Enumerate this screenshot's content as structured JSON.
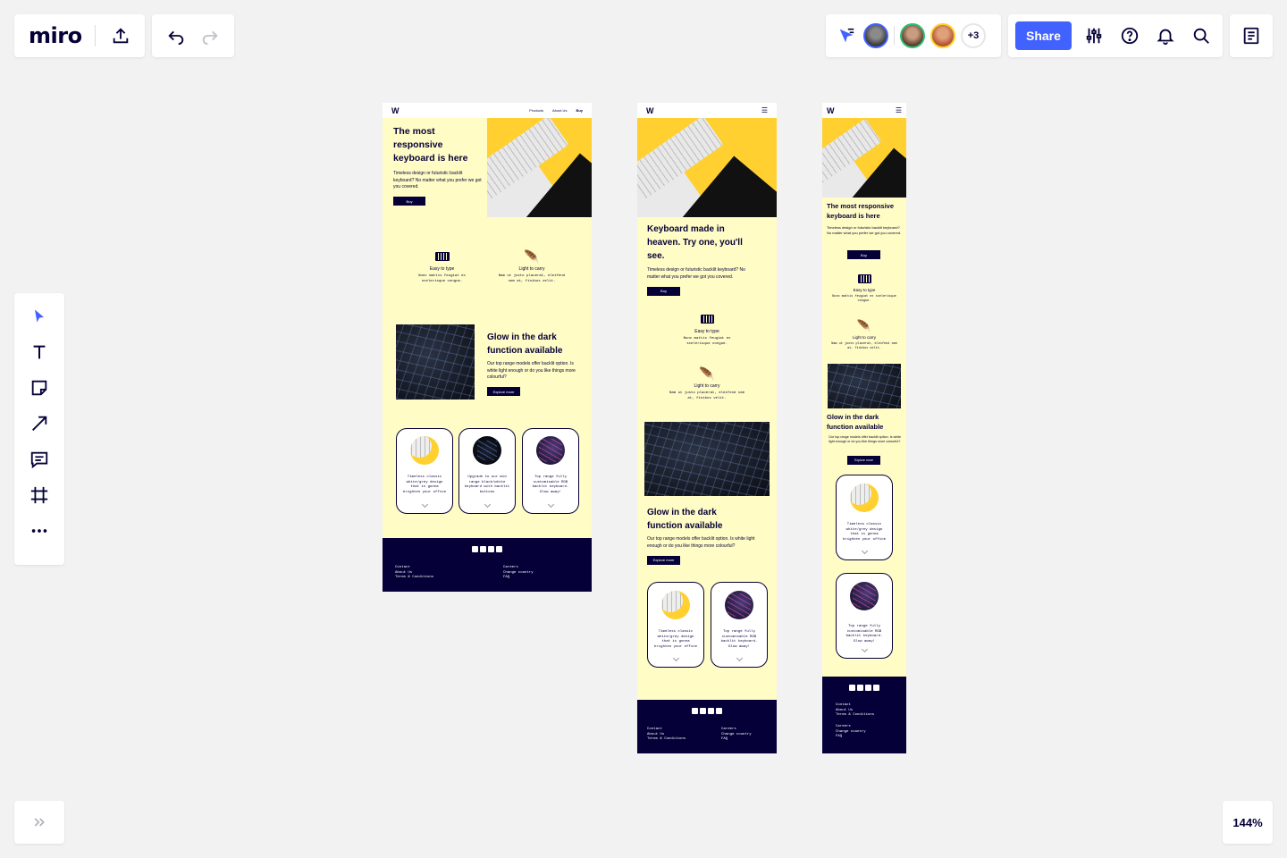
{
  "app": {
    "logo": "miro",
    "zoom": "144%"
  },
  "topbar": {
    "share_label": "Share",
    "collab_more": "+3"
  },
  "frames": {
    "desktop": {
      "nav": [
        "Products",
        "About Us",
        "Buy"
      ],
      "hero_title": "The most responsive keyboard is here",
      "hero_text": "Timeless design or futuristic backlit keyboard? No matter what you prefer we got you covered.",
      "hero_btn": "Buy",
      "feature1_title": "Easy to type",
      "feature1_text": "Nunc mattis feugiat ex scelerisque congue.",
      "feature2_title": "Light to carry",
      "feature2_text": "Nam ut justo placerat, eleifend sem at, finibus velit.",
      "glow_title": "Glow in the dark function available",
      "glow_text": "Our top range models offer backlit option. Is white light enough or do you like things more colourful?",
      "glow_btn": "Explore more",
      "card1": "Timeless classic white/grey design that is gonna brighten your office",
      "card2": "Upgrade to our mid range black/white keyboard with backlit buttons",
      "card3": "Top range fully customisable RGB backlit keyboard. Glow away!",
      "footer_left": [
        "Contact",
        "About Us",
        "Terms & Conditions"
      ],
      "footer_right": [
        "Careers",
        "Change country",
        "FAQ"
      ]
    },
    "tablet": {
      "hero_title": "Keyboard made in heaven. Try one, you'll see.",
      "hero_text": "Timeless design or futuristic backlit keyboard? No matter what you prefer we got you covered.",
      "hero_btn": "Buy",
      "feature1_title": "Easy to type",
      "feature1_text": "Nunc mattis feugiat ex scelerisque congue.",
      "feature2_title": "Light to carry",
      "feature2_text": "Nam ut justo placerat, eleifend sem at, finibus velit.",
      "glow_title": "Glow in the dark function available",
      "glow_text": "Our top range models offer backlit option. Is white light enough or do you like things more colourful?",
      "glow_btn": "Explore more",
      "card1": "Timeless classic white/grey design that is gonna brighten your office",
      "card2": "Top range fully customisable RGB backlit keyboard. Glow away!",
      "footer_left": [
        "Contact",
        "About Us",
        "Terms & Conditions"
      ],
      "footer_right": [
        "Careers",
        "Change country",
        "FAQ"
      ]
    },
    "mobile": {
      "hero_title": "The most responsive keyboard is here",
      "hero_text": "Timeless design or futuristic backlit keyboard? No matter what you prefer we got you covered.",
      "hero_btn": "Buy",
      "feature1_title": "Easy to type",
      "feature1_text": "Nunc mattis feugiat ex scelerisque congue.",
      "feature2_title": "Light to carry",
      "feature2_text": "Nam ut justo placerat, eleifend sem at, finibus velit.",
      "glow_title": "Glow in the dark function available",
      "glow_text": "Our top range models offer backlit option. Is white light enough or do you like things more colourful?",
      "glow_btn": "Explore more",
      "card1": "Timeless classic white/grey design that is gonna brighten your office",
      "card2": "Top range fully customisable RGB backlit keyboard. Glow away!",
      "footer_left": [
        "Contact",
        "About Us",
        "Terms & Conditions"
      ],
      "footer_right": [
        "Careers",
        "Change country",
        "FAQ"
      ]
    }
  },
  "colors": {
    "accent": "#4262ff",
    "frame_bg": "#fffcc5",
    "navy": "#050038",
    "yellow": "#ffd02f"
  }
}
